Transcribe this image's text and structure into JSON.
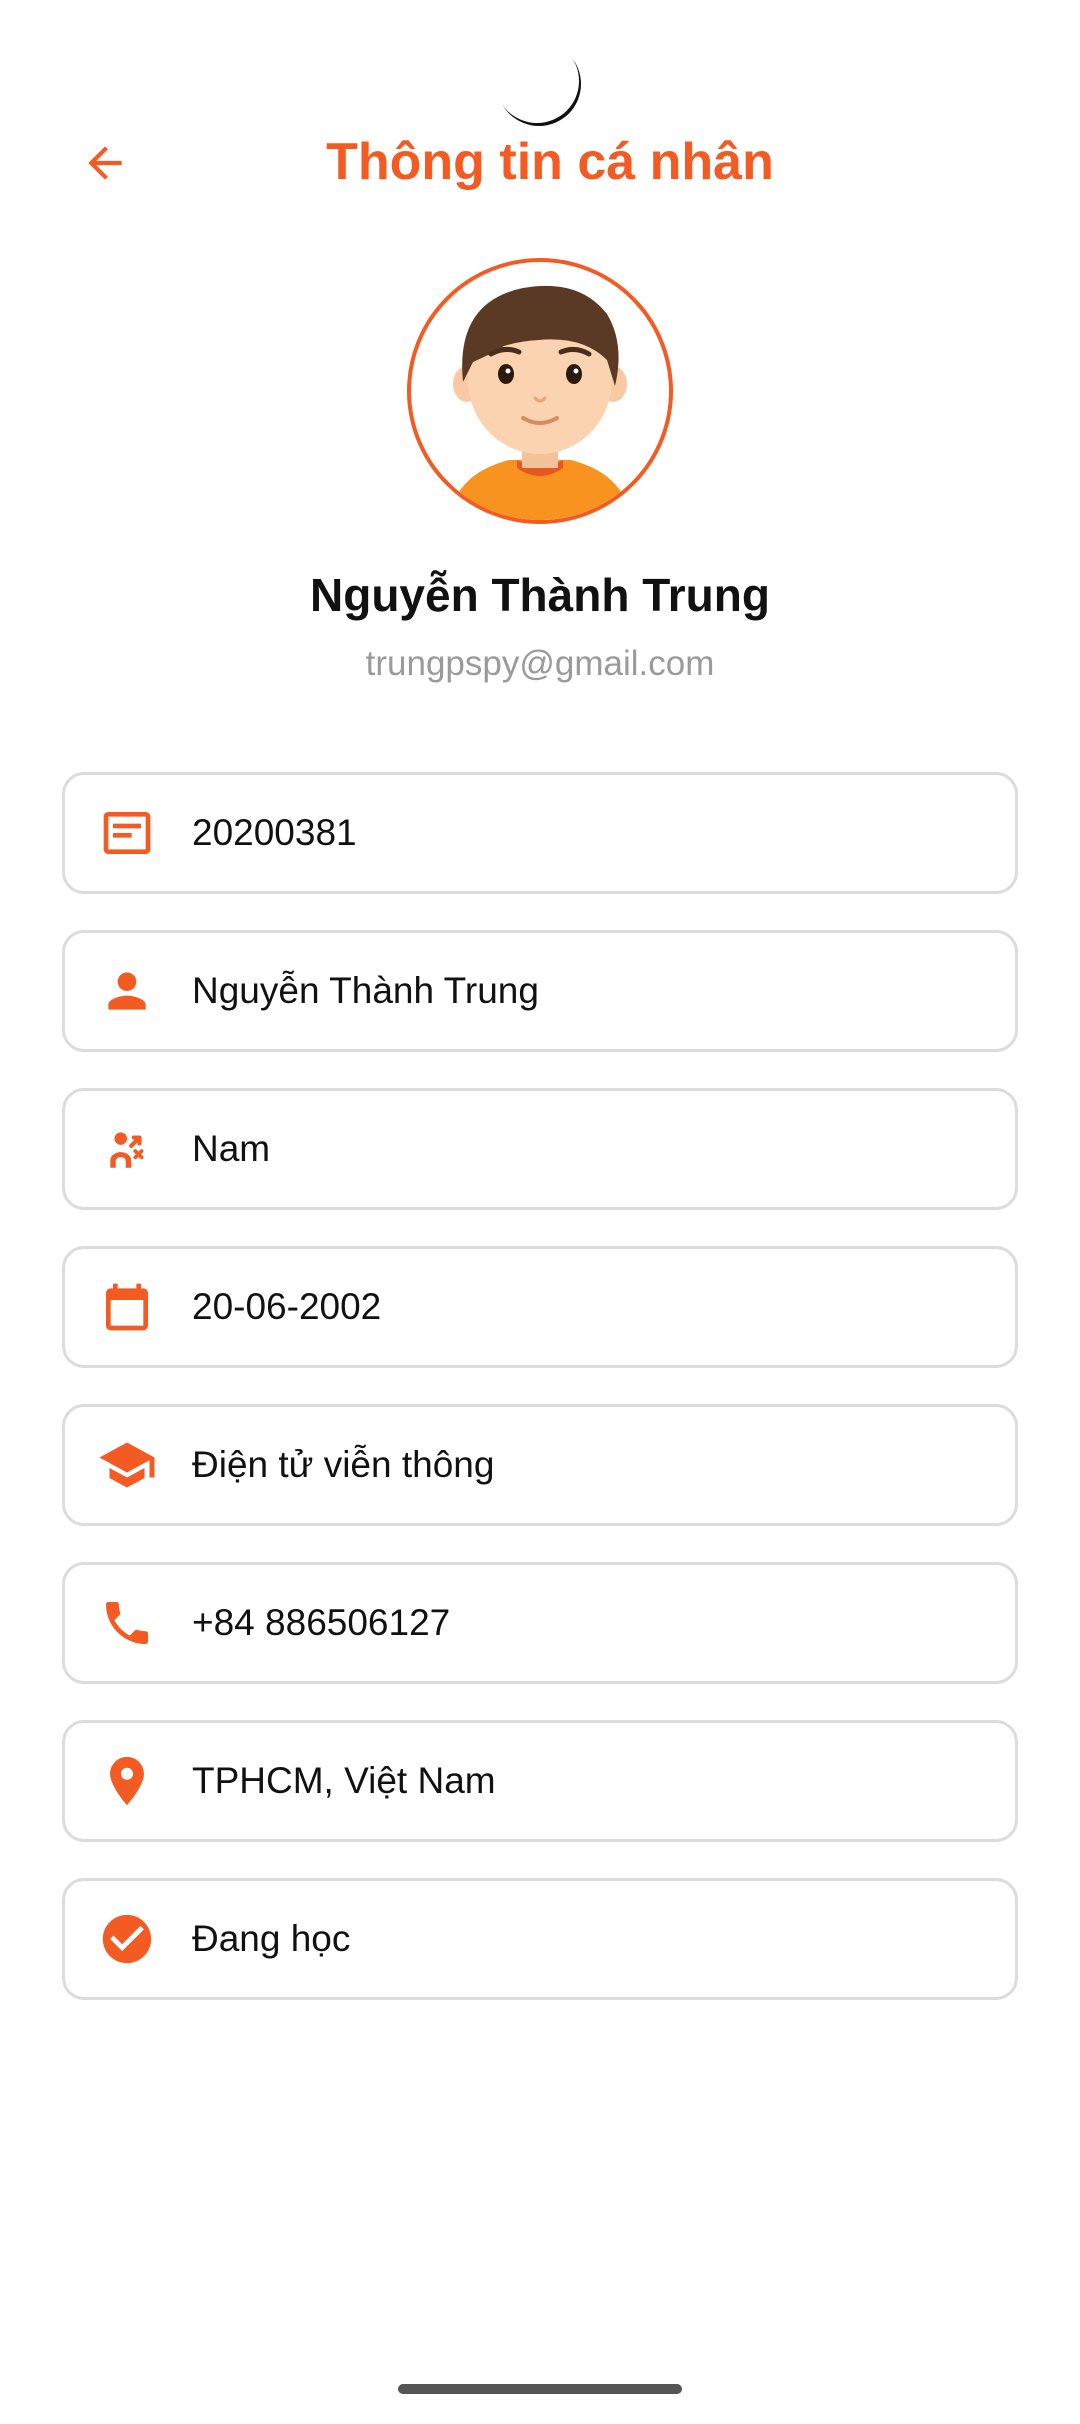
{
  "header": {
    "title": "Thông tin cá nhân",
    "back_icon": "arrow-left-icon"
  },
  "profile": {
    "avatar_icon": "cartoon-boy-avatar",
    "name": "Nguyễn Thành Trung",
    "email": "trungpspy@gmail.com"
  },
  "info": [
    {
      "icon": "id-card-icon",
      "value": "20200381"
    },
    {
      "icon": "person-icon",
      "value": "Nguyễn Thành Trung"
    },
    {
      "icon": "gender-icon",
      "value": "Nam"
    },
    {
      "icon": "calendar-icon",
      "value": "20-06-2002"
    },
    {
      "icon": "graduation-cap-icon",
      "value": "Điện tử viễn thông"
    },
    {
      "icon": "phone-icon",
      "value": "+84 886506127"
    },
    {
      "icon": "location-pin-icon",
      "value": "TPHCM, Việt Nam"
    },
    {
      "icon": "check-circle-icon",
      "value": "Đang học"
    }
  ],
  "colors": {
    "accent": "#f35b23",
    "text": "#111111",
    "muted": "#9a9a9a",
    "card_border": "#dcdcdc"
  }
}
